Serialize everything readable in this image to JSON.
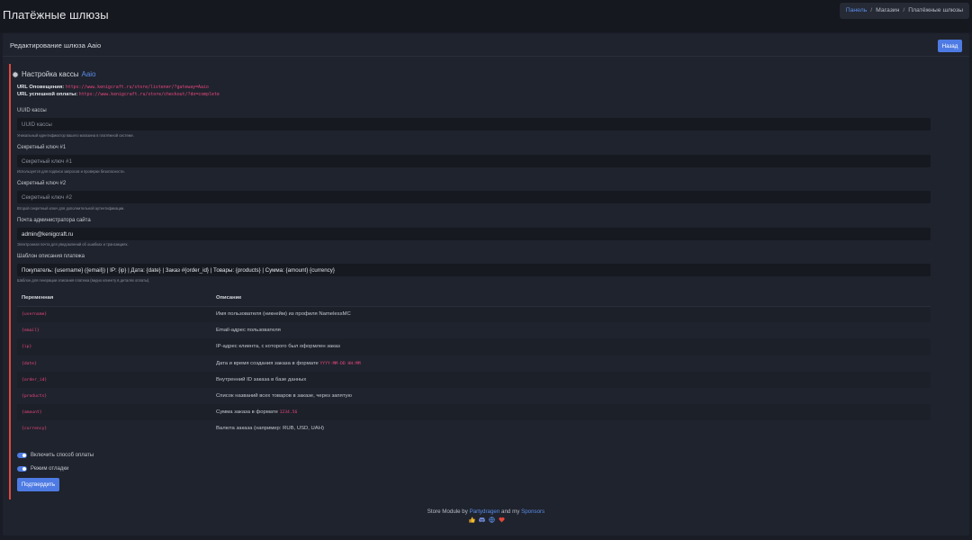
{
  "page": {
    "title": "Платёжные шлюзы"
  },
  "breadcrumb": {
    "items": [
      "Панель",
      "Магазин",
      "Платёжные шлюзы"
    ],
    "separator": "/"
  },
  "card": {
    "title": "Редактирование шлюза Aaio",
    "back_label": "Назад"
  },
  "section": {
    "title": "Настройка кассы",
    "accent": "Aaio",
    "icon": "gear-icon"
  },
  "urls": {
    "notify_label": "URL Оповещения:",
    "notify_value": "https://www.kenigcraft.ru/store/listener/?gateway=Aaio",
    "success_label": "URL успешной оплаты:",
    "success_value": "https://www.kenigcraft.ru/store/checkout/?do=complete"
  },
  "fields": {
    "uuid": {
      "label": "UUID кассы",
      "placeholder": "UUID кассы",
      "value": "",
      "help": "Уникальный идентификатор вашего магазина в платёжной системе."
    },
    "secret1": {
      "label": "Секретный ключ #1",
      "placeholder": "Секретный ключ #1",
      "value": "",
      "help": "Используется для подписи запросов и проверки безопасности."
    },
    "secret2": {
      "label": "Секретный ключ #2",
      "placeholder": "Секретный ключ #2",
      "value": "",
      "help": "Второй секретный ключ для дополнительной аутентификации."
    },
    "email": {
      "label": "Почта администратора сайта",
      "placeholder": "",
      "value": "admin@kenigcraft.ru",
      "help": "Электронная почта для уведомлений об ошибках и транзакциях."
    },
    "template": {
      "label": "Шаблон описания платежа",
      "placeholder": "",
      "value": "Покупатель: {username} ({email}) | IP: {ip} | Дата: {date} | Заказ #{order_id} | Товары: {products} | Сумма: {amount} {currency}",
      "help": "Шаблон для генерации описания платежа (видно клиенту в деталях оплаты)."
    }
  },
  "table": {
    "headers": [
      "Переменная",
      "Описание"
    ],
    "rows": [
      {
        "var": "{username}",
        "desc": "Имя пользователя (никнейм) из профиля NamelessMC",
        "code": ""
      },
      {
        "var": "{email}",
        "desc": "Email-адрес пользователя",
        "code": ""
      },
      {
        "var": "{ip}",
        "desc": "IP-адрес клиента, с которого был оформлен заказ",
        "code": ""
      },
      {
        "var": "{date}",
        "desc": "Дата и время создания заказа в формате",
        "code": "YYYY-MM-DD HH:MM"
      },
      {
        "var": "{order_id}",
        "desc": "Внутренний ID заказа в базе данных",
        "code": ""
      },
      {
        "var": "{products}",
        "desc": "Список названий всех товаров в заказе, через запятую",
        "code": ""
      },
      {
        "var": "{amount}",
        "desc": "Сумма заказа в формате",
        "code": "1234.56"
      },
      {
        "var": "{currency}",
        "desc": "Валюта заказа (например: RUB, USD, UAH)",
        "code": ""
      }
    ]
  },
  "toggles": {
    "enable": {
      "label": "Включить способ оплаты",
      "checked": true
    },
    "debug": {
      "label": "Режим отладки",
      "checked": true
    }
  },
  "submit_label": "Подтвердить",
  "footer": {
    "prefix": "Store Module by",
    "author": "Partydragen",
    "middle": "and my",
    "sponsors": "Sponsors",
    "icons": [
      "thumbs-up-icon",
      "discord-icon",
      "globe-icon",
      "heart-icon"
    ]
  },
  "colors": {
    "accent": "#4e7be3",
    "link": "#5a8de8",
    "code": "#e8477e",
    "panel_border": "#e3473b",
    "background": "#191c24"
  }
}
